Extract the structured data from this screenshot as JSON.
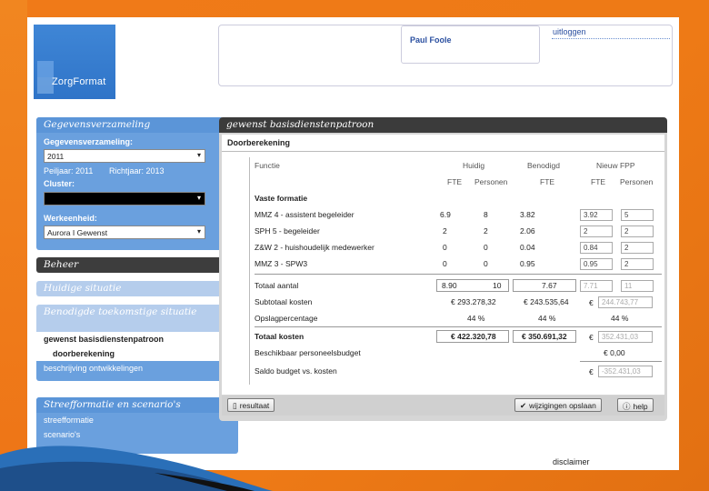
{
  "header": {
    "logo_text": "ZorgFormat",
    "user_name": "Paul Foole",
    "logout": "uitloggen"
  },
  "sidebar": {
    "gegevens": {
      "title": "Gegevensverzameling",
      "label_gegevensverzameling": "Gegevensverzameling:",
      "value_gegevensverzameling": "2011",
      "peiljaar": "Peiljaar: 2011",
      "richtjaar": "Richtjaar: 2013",
      "label_cluster": "Cluster:",
      "value_cluster": "",
      "label_werkeenheid": "Werkeenheid:",
      "value_werkeenheid": "Aurora I Gewenst"
    },
    "beheer": "Beheer",
    "huidige": "Huidige situatie",
    "benodigde": {
      "title": "Benodigde toekomstige situatie",
      "items": [
        "gewenst basisdienstenpatroon",
        "doorberekening",
        "beschrijving ontwikkelingen"
      ]
    },
    "streef": {
      "title": "Streefformatie en scenario's",
      "items": [
        "streefformatie",
        "scenario's"
      ]
    }
  },
  "main": {
    "title": "gewenst basisdienstenpatroon",
    "tab": "Doorberekening",
    "columns": {
      "functie": "Functie",
      "huidig": "Huidig",
      "benodigd": "Benodigd",
      "nieuw": "Nieuw FPP",
      "fte": "FTE",
      "personen": "Personen"
    },
    "section_label": "Vaste formatie",
    "rows": [
      {
        "functie": "MMZ 4 - assistent begeleider",
        "h_fte": "6.9",
        "h_pers": "8",
        "b_fte": "3.82",
        "n_fte": "3.92",
        "n_pers": "5"
      },
      {
        "functie": "SPH 5 - begeleider",
        "h_fte": "2",
        "h_pers": "2",
        "b_fte": "2.06",
        "n_fte": "2",
        "n_pers": "2"
      },
      {
        "functie": "Z&W 2 - huishoudelijk medewerker",
        "h_fte": "0",
        "h_pers": "0",
        "b_fte": "0.04",
        "n_fte": "0.84",
        "n_pers": "2"
      },
      {
        "functie": "MMZ 3 - SPW3",
        "h_fte": "0",
        "h_pers": "0",
        "b_fte": "0.95",
        "n_fte": "0.95",
        "n_pers": "2"
      }
    ],
    "totaal": {
      "label": "Totaal aantal",
      "h_fte": "8.90",
      "h_pers": "10",
      "b_fte": "7.67",
      "n_fte": "7.71",
      "n_pers": "11"
    },
    "subtotaal": {
      "label": "Subtotaal kosten",
      "h": "€ 293.278,32",
      "b": "€ 243.535,64",
      "n_euro": "€",
      "n": "244.743,77"
    },
    "opslag": {
      "label": "Opslagpercentage",
      "h": "44 %",
      "b": "44 %",
      "n": "44 %"
    },
    "totaal_kosten": {
      "label": "Totaal kosten",
      "h": "€ 422.320,78",
      "b": "€ 350.691,32",
      "n_euro": "€",
      "n": "352.431,03"
    },
    "budget": {
      "label": "Beschikbaar personeelsbudget",
      "n": "€ 0,00"
    },
    "saldo": {
      "label": "Saldo budget vs. kosten",
      "n_euro": "€",
      "n": "-352.431,03"
    }
  },
  "footer": {
    "resultaat": "resultaat",
    "opslaan": "wijzigingen opslaan",
    "help": "help"
  },
  "disclaimer": "disclaimer"
}
